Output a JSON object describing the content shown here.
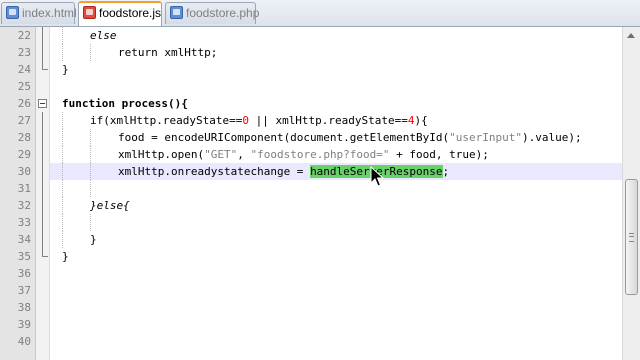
{
  "tabs": [
    {
      "label": "index.html",
      "state": "saved",
      "active": false
    },
    {
      "label": "foodstore.js",
      "state": "unsaved",
      "active": true
    },
    {
      "label": "foodstore.php",
      "state": "saved",
      "active": false
    }
  ],
  "editor": {
    "current_line": 30,
    "lines": [
      {
        "number": "22",
        "text": "else"
      },
      {
        "number": "23",
        "text": "return xmlHttp;"
      },
      {
        "number": "24",
        "text": "}"
      },
      {
        "number": "25",
        "text": ""
      },
      {
        "number": "26",
        "text": "function process(){"
      },
      {
        "number": "27",
        "text": "if(xmlHttp.readyState==0 || xmlHttp.readyState==4){"
      },
      {
        "number": "28",
        "text": "food = encodeURIComponent(document.getElementById(\"userInput\").value);"
      },
      {
        "number": "29",
        "text": "xmlHttp.open(\"GET\", \"foodstore.php?food=\" + food, true);"
      },
      {
        "number": "30",
        "text": "xmlHttp.onreadystatechange = handleServerResponse;"
      },
      {
        "number": "31",
        "text": ""
      },
      {
        "number": "32",
        "text": "}else{"
      },
      {
        "number": "33",
        "text": ""
      },
      {
        "number": "34",
        "text": "}"
      },
      {
        "number": "35",
        "text": "}"
      },
      {
        "number": "36",
        "text": ""
      },
      {
        "number": "37",
        "text": ""
      },
      {
        "number": "38",
        "text": ""
      },
      {
        "number": "39",
        "text": ""
      },
      {
        "number": "40",
        "text": ""
      }
    ],
    "selected_text": "handleServerResponse"
  },
  "colors": {
    "selection": "#6ad16a",
    "current_line": "#e8e8ff",
    "number_literal": "#ff0000",
    "string_literal": "#808080",
    "active_tab_accent": "#f0a030"
  },
  "icons": {
    "tab_saved": "disk-blue-icon",
    "tab_unsaved": "disk-red-icon",
    "cursor": "arrow-pointer-icon"
  }
}
